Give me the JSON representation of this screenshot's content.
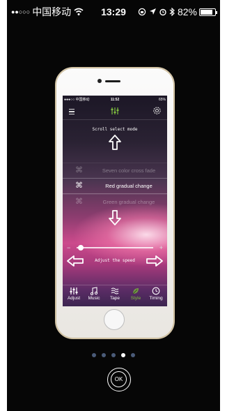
{
  "status_bar": {
    "carrier": "中国移动",
    "time": "13:29",
    "battery": "82%",
    "battery_level": 0.82
  },
  "phone_status_bar": {
    "carrier": "中国移动",
    "time": "11:52",
    "battery": "65%"
  },
  "app": {
    "mode_title": "Scroll select mode",
    "modes": [
      {
        "label": "Seven color cross fade",
        "state": "faded"
      },
      {
        "label": "Red gradual change",
        "state": "selected"
      },
      {
        "label": "Green gradual change",
        "state": "faded"
      }
    ],
    "speed_label": "Adjust the speed",
    "speed_level": 0.02,
    "tabs": [
      {
        "label": "Adjust",
        "icon": "sliders-icon"
      },
      {
        "label": "Music",
        "icon": "music-note-icon"
      },
      {
        "label": "Tape",
        "icon": "wave-icon"
      },
      {
        "label": "Style",
        "icon": "leaf-icon",
        "active": true
      },
      {
        "label": "Timing",
        "icon": "clock-icon"
      }
    ]
  },
  "pager": {
    "total": 5,
    "current": 4
  },
  "ok_button": {
    "label": "OK"
  },
  "colors": {
    "accent_green": "#7fbf3f",
    "pager_inactive": "#4a5b78",
    "background": "#060606"
  }
}
